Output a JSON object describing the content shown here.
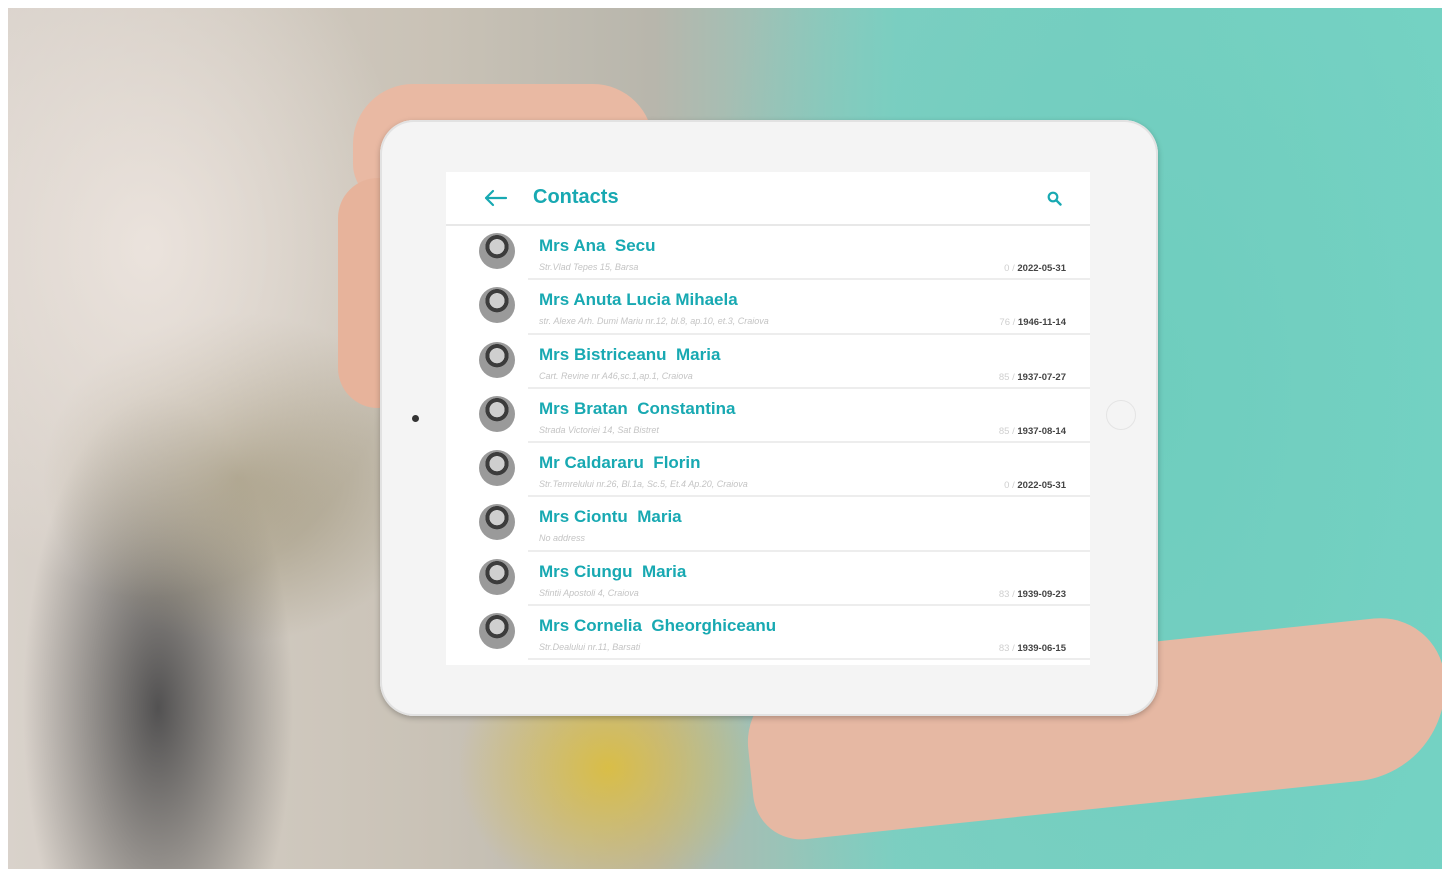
{
  "header": {
    "title": "Contacts",
    "back_icon": "arrow-left-icon",
    "search_icon": "search-icon"
  },
  "colors": {
    "accent": "#18a9b2",
    "muted": "#c4c4c4",
    "date": "#444444"
  },
  "contacts": [
    {
      "name": "Mrs Ana  Secu",
      "address": "Str.Vlad Tepes 15, Barsa",
      "age": "0",
      "date": "2022-05-31"
    },
    {
      "name": "Mrs Anuta Lucia Mihaela",
      "address": "str. Alexe Arh. Dumi Mariu nr.12, bl.8, ap.10, et.3, Craiova",
      "age": "76",
      "date": "1946-11-14"
    },
    {
      "name": "Mrs Bistriceanu  Maria",
      "address": "Cart. Revine nr A46,sc.1,ap.1, Craiova",
      "age": "85",
      "date": "1937-07-27"
    },
    {
      "name": "Mrs Bratan  Constantina",
      "address": "Strada Victoriei 14, Sat Bistret",
      "age": "85",
      "date": "1937-08-14"
    },
    {
      "name": "Mr Caldararu  Florin",
      "address": "Str.Temrelului nr.26, Bl.1a, Sc.5, Et.4 Ap.20, Craiova",
      "age": "0",
      "date": "2022-05-31"
    },
    {
      "name": "Mrs Ciontu  Maria",
      "address": "No address",
      "age": "",
      "date": ""
    },
    {
      "name": "Mrs Ciungu  Maria",
      "address": "Sfintii Apostoli 4, Craiova",
      "age": "83",
      "date": "1939-09-23"
    },
    {
      "name": "Mrs Cornelia  Gheorghiceanu",
      "address": "Str.Dealului nr.11, Barsati",
      "age": "83",
      "date": "1939-06-15"
    }
  ]
}
